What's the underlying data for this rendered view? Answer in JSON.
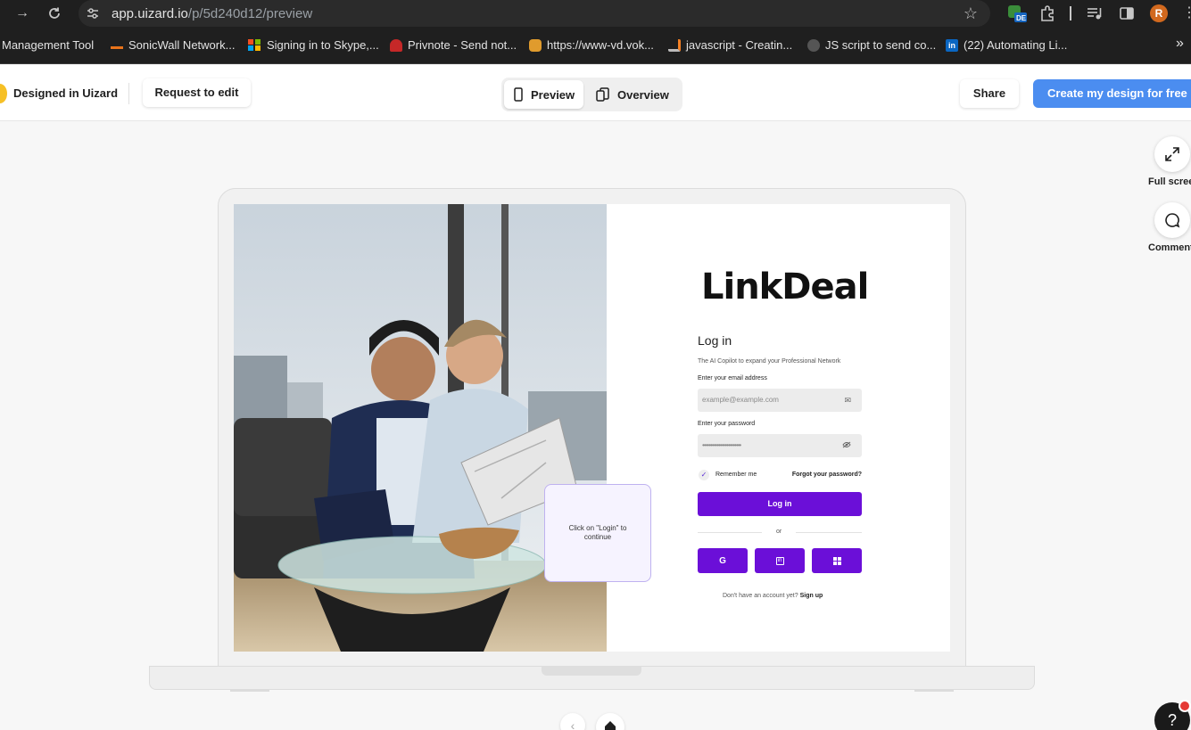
{
  "browser": {
    "url_host": "app.uizard.io",
    "url_path": "/p/5d240d12/preview",
    "avatar_letter": "R",
    "ext_badge": "DE",
    "bookmarks": [
      {
        "label": "Management Tool",
        "color": ""
      },
      {
        "label": "SonicWall Network...",
        "color": "#e8731a"
      },
      {
        "label": "Signing in to Skype,...",
        "color": "#2f7df6"
      },
      {
        "label": "Privnote - Send not...",
        "color": "#c62828"
      },
      {
        "label": "https://www-vd.vok...",
        "color": "#e09b2d"
      },
      {
        "label": "javascript - Creatin...",
        "color": "#f48024"
      },
      {
        "label": "JS script to send co...",
        "color": "#555555"
      },
      {
        "label": "(22) Automating Li...",
        "color": "#0a66c2"
      }
    ],
    "bookmarks_overflow": "»"
  },
  "header": {
    "designed_label": "Designed in Uizard",
    "request_label": "Request to edit",
    "tab_preview": "Preview",
    "tab_overview": "Overview",
    "share_label": "Share",
    "create_label": "Create my design for free"
  },
  "side_tools": {
    "fullscreen_label": "Full scree",
    "comments_label": "Comment"
  },
  "screen": {
    "logo": "LinkDeal",
    "title": "Log in",
    "subtitle": "The AI Copilot to expand your Professional Network",
    "email_label": "Enter your email address",
    "email_placeholder": "example@example.com",
    "password_label": "Enter your password",
    "password_value": "••••••••••••••••••••••••",
    "remember_label": "Remember me",
    "forgot_label": "Forgot your password?",
    "login_button": "Log in",
    "or_text": "or",
    "no_account_text": "Don't have an account yet?",
    "signup_link": "Sign up",
    "brand_color": "#6b0fd8"
  },
  "hotspot": {
    "text": "Click on \"Login\" to continue"
  },
  "help": {
    "label": "?"
  }
}
